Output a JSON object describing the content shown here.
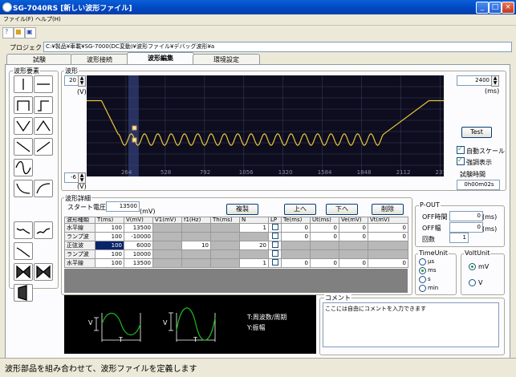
{
  "window": {
    "title": "SG-7040RS [新しい波形ファイル]"
  },
  "menu": [
    {
      "label": "ファイル(F)"
    },
    {
      "label": "ヘルプ(H)"
    }
  ],
  "project": {
    "label": "プロジェクト",
    "path": "C:¥製品¥車載¥SG-7000(DC変動)¥波形ファイル¥デバッグ波形¥a"
  },
  "tabs": [
    {
      "label": "試験"
    },
    {
      "label": "波形接続"
    },
    {
      "label": "波形編集"
    },
    {
      "label": "環境設定"
    }
  ],
  "elements_group": {
    "title": "波形要素"
  },
  "waveform": {
    "title": "波形",
    "y_top": "20",
    "y_bottom": "-6",
    "y_unit": "(V)",
    "time_value": "2400",
    "time_unit": "(ms)",
    "x_ticks": [
      "264",
      "528",
      "792",
      "1056",
      "1320",
      "1584",
      "1848",
      "2112",
      "2376"
    ],
    "test_label": "Test",
    "auto_scale": "自動スケール",
    "highlight": "強調表示",
    "test_time_label": "試験時間",
    "test_time": "0h00m02s"
  },
  "chart_data": {
    "type": "line",
    "xlim": [
      0,
      2400
    ],
    "ylim": [
      -6,
      20
    ],
    "segments": [
      {
        "name": "水平線",
        "type": "hold",
        "t": 100,
        "v": 13.5
      },
      {
        "name": "ランプ波",
        "type": "ramp",
        "t": 100,
        "v": -10
      },
      {
        "name": "正弦波",
        "type": "sine",
        "t": 100,
        "v": 6,
        "n": 20
      },
      {
        "name": "ランプ波",
        "type": "ramp",
        "t": 100,
        "v": 10
      },
      {
        "name": "水平線",
        "type": "hold",
        "t": 100,
        "v": 13.5
      }
    ],
    "curve_points": [
      [
        0,
        13.5
      ],
      [
        100,
        13.5
      ],
      [
        210,
        3.5
      ],
      [
        2000,
        3.5
      ],
      [
        2300,
        13.5
      ],
      [
        2400,
        13.5
      ]
    ],
    "highlight_range": [
      280,
      350
    ]
  },
  "detail": {
    "title": "波形詳細",
    "start_label": "スタート電圧",
    "start_value": "13500",
    "start_unit": "(mV)",
    "buttons": {
      "copy": "複製",
      "up": "上へ",
      "down": "下へ",
      "delete": "削除"
    },
    "columns": [
      "波形種類",
      "T(ms)",
      "V(mV)",
      "V1(mV)",
      "f1(Hz)",
      "Th(ms)",
      "N",
      "LP",
      "Te(ms)",
      "Ut(ms)",
      "Ve(mV)",
      "Vt(mV)"
    ],
    "rows": [
      {
        "name": "水平線",
        "t": "100",
        "v": "13500",
        "v1": "",
        "f1": "",
        "th": "",
        "n": "1",
        "te": "0",
        "ut": "0",
        "ve": "0",
        "vt": "0"
      },
      {
        "name": "ランプ波",
        "t": "100",
        "v": "-10000",
        "v1": "",
        "f1": "",
        "th": "",
        "n": "",
        "te": "0",
        "ut": "0",
        "ve": "0",
        "vt": "0"
      },
      {
        "name": "正弦波",
        "t": "100",
        "v": "6000",
        "v1": "",
        "f1": "10",
        "th": "",
        "n": "20",
        "te": "",
        "ut": "",
        "ve": "",
        "vt": ""
      },
      {
        "name": "ランプ波",
        "t": "100",
        "v": "10000",
        "v1": "",
        "f1": "",
        "th": "",
        "n": "",
        "te": "",
        "ut": "",
        "ve": "",
        "vt": ""
      },
      {
        "name": "水平線",
        "t": "100",
        "v": "13500",
        "v1": "",
        "f1": "",
        "th": "",
        "n": "1",
        "te": "0",
        "ut": "0",
        "ve": "0",
        "vt": "0"
      }
    ]
  },
  "pout": {
    "title": "P-OUT",
    "off_time_label": "OFF時間",
    "off_time": "0",
    "off_time_unit": "(ms)",
    "off_width_label": "OFF幅",
    "off_width": "0",
    "off_width_unit": "(ms)",
    "count_label": "回数",
    "count": "1"
  },
  "time_unit": {
    "title": "TimeUnit",
    "options": [
      "μs",
      "ms",
      "s",
      "min"
    ],
    "selected": "ms"
  },
  "volt_unit": {
    "title": "VoltUnit",
    "options": [
      "mV",
      "V"
    ],
    "selected": "mV"
  },
  "help": {
    "t_label": "T:周波数/周期",
    "v_label": "Y:振幅",
    "t": "T",
    "v": "V"
  },
  "comment": {
    "title": "コメント",
    "text": "ここには自由にコメントを入力できます"
  },
  "status": {
    "text": "波形部品を組み合わせて、波形ファイルを定義します"
  },
  "colors": {
    "plot_bg": "#0d0d1f",
    "curve": "#e6c53a",
    "highlight": "#3a4a8a",
    "grid": "#3e3e5a"
  }
}
